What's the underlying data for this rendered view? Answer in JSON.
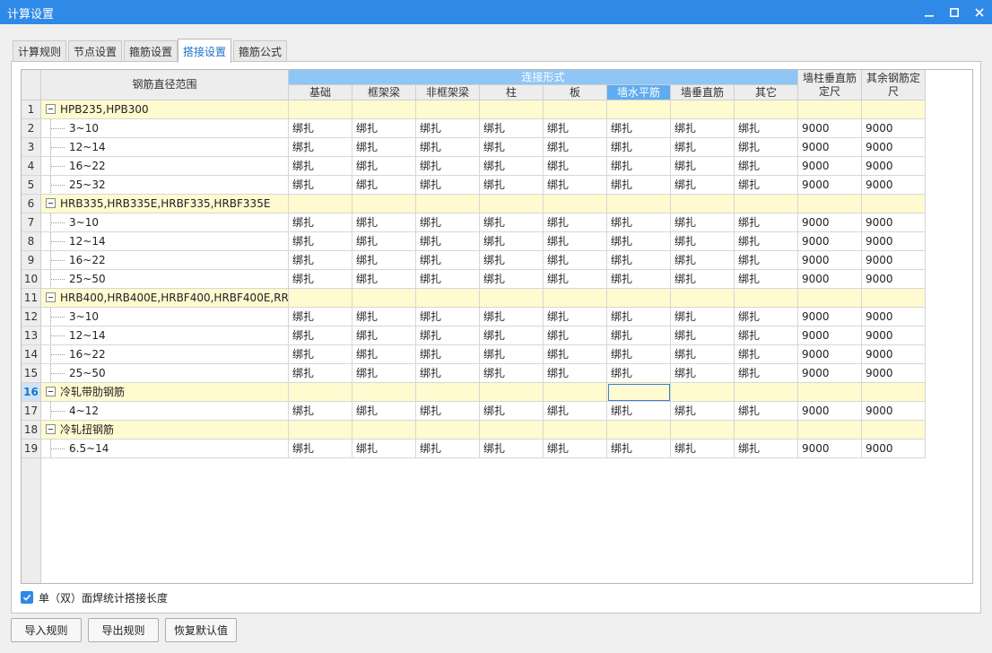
{
  "window": {
    "title": "计算设置"
  },
  "tabs": [
    {
      "label": "计算规则",
      "active": false
    },
    {
      "label": "节点设置",
      "active": false
    },
    {
      "label": "箍筋设置",
      "active": false
    },
    {
      "label": "搭接设置",
      "active": true
    },
    {
      "label": "箍筋公式",
      "active": false
    }
  ],
  "table": {
    "headers": {
      "range": "钢筋直径范围",
      "connection_group": "连接形式",
      "columns": [
        "基础",
        "框架梁",
        "非框架梁",
        "柱",
        "板",
        "墙水平筋",
        "墙垂直筋",
        "其它"
      ],
      "fixed_length_a": "墙柱垂直筋定尺",
      "fixed_length_b": "其余钢筋定尺"
    },
    "selected_column": 5,
    "rows": [
      {
        "num": "1",
        "label": "HPB235,HPB300",
        "group": true
      },
      {
        "num": "2",
        "label": "3~10",
        "values": [
          "绑扎",
          "绑扎",
          "绑扎",
          "绑扎",
          "绑扎",
          "绑扎",
          "绑扎",
          "绑扎",
          "9000",
          "9000"
        ]
      },
      {
        "num": "3",
        "label": "12~14",
        "values": [
          "绑扎",
          "绑扎",
          "绑扎",
          "绑扎",
          "绑扎",
          "绑扎",
          "绑扎",
          "绑扎",
          "9000",
          "9000"
        ]
      },
      {
        "num": "4",
        "label": "16~22",
        "values": [
          "绑扎",
          "绑扎",
          "绑扎",
          "绑扎",
          "绑扎",
          "绑扎",
          "绑扎",
          "绑扎",
          "9000",
          "9000"
        ]
      },
      {
        "num": "5",
        "label": "25~32",
        "values": [
          "绑扎",
          "绑扎",
          "绑扎",
          "绑扎",
          "绑扎",
          "绑扎",
          "绑扎",
          "绑扎",
          "9000",
          "9000"
        ]
      },
      {
        "num": "6",
        "label": "HRB335,HRB335E,HRBF335,HRBF335E",
        "group": true
      },
      {
        "num": "7",
        "label": "3~10",
        "values": [
          "绑扎",
          "绑扎",
          "绑扎",
          "绑扎",
          "绑扎",
          "绑扎",
          "绑扎",
          "绑扎",
          "9000",
          "9000"
        ]
      },
      {
        "num": "8",
        "label": "12~14",
        "values": [
          "绑扎",
          "绑扎",
          "绑扎",
          "绑扎",
          "绑扎",
          "绑扎",
          "绑扎",
          "绑扎",
          "9000",
          "9000"
        ]
      },
      {
        "num": "9",
        "label": "16~22",
        "values": [
          "绑扎",
          "绑扎",
          "绑扎",
          "绑扎",
          "绑扎",
          "绑扎",
          "绑扎",
          "绑扎",
          "9000",
          "9000"
        ]
      },
      {
        "num": "10",
        "label": "25~50",
        "values": [
          "绑扎",
          "绑扎",
          "绑扎",
          "绑扎",
          "绑扎",
          "绑扎",
          "绑扎",
          "绑扎",
          "9000",
          "9000"
        ]
      },
      {
        "num": "11",
        "label": "HRB400,HRB400E,HRBF400,HRBF400E,RR...",
        "group": true
      },
      {
        "num": "12",
        "label": "3~10",
        "values": [
          "绑扎",
          "绑扎",
          "绑扎",
          "绑扎",
          "绑扎",
          "绑扎",
          "绑扎",
          "绑扎",
          "9000",
          "9000"
        ]
      },
      {
        "num": "13",
        "label": "12~14",
        "values": [
          "绑扎",
          "绑扎",
          "绑扎",
          "绑扎",
          "绑扎",
          "绑扎",
          "绑扎",
          "绑扎",
          "9000",
          "9000"
        ]
      },
      {
        "num": "14",
        "label": "16~22",
        "values": [
          "绑扎",
          "绑扎",
          "绑扎",
          "绑扎",
          "绑扎",
          "绑扎",
          "绑扎",
          "绑扎",
          "9000",
          "9000"
        ]
      },
      {
        "num": "15",
        "label": "25~50",
        "values": [
          "绑扎",
          "绑扎",
          "绑扎",
          "绑扎",
          "绑扎",
          "绑扎",
          "绑扎",
          "绑扎",
          "9000",
          "9000"
        ]
      },
      {
        "num": "16",
        "label": "冷轧带肋钢筋",
        "group": true,
        "active": true
      },
      {
        "num": "17",
        "label": "4~12",
        "values": [
          "绑扎",
          "绑扎",
          "绑扎",
          "绑扎",
          "绑扎",
          "绑扎",
          "绑扎",
          "绑扎",
          "9000",
          "9000"
        ]
      },
      {
        "num": "18",
        "label": "冷轧扭钢筋",
        "group": true
      },
      {
        "num": "19",
        "label": "6.5~14",
        "values": [
          "绑扎",
          "绑扎",
          "绑扎",
          "绑扎",
          "绑扎",
          "绑扎",
          "绑扎",
          "绑扎",
          "9000",
          "9000"
        ]
      }
    ]
  },
  "options": {
    "weld_checkbox_label": "单（双）面焊统计搭接长度",
    "weld_checked": true
  },
  "buttons": {
    "import": "导入规则",
    "export": "导出规则",
    "restore": "恢复默认值"
  },
  "colors": {
    "titlebar": "#2e8ae6",
    "header_blue": "#8fc6f5",
    "group_row": "#fffad0",
    "active_tab_text": "#1a73c9"
  }
}
